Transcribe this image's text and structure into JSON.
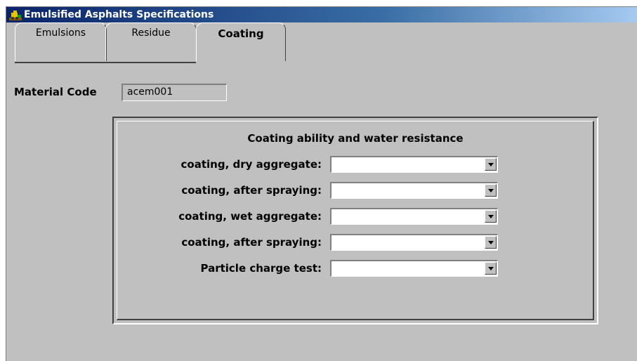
{
  "window": {
    "title": "Emulsified Asphalts Specifications",
    "icon": "bulldozer-app-icon"
  },
  "tabs": [
    {
      "label": "Emulsions",
      "active": false
    },
    {
      "label": "Residue",
      "active": false
    },
    {
      "label": "Coating",
      "active": true
    }
  ],
  "material_code": {
    "label": "Material Code",
    "value": "acem001"
  },
  "group": {
    "title": "Coating ability and water resistance",
    "fields": [
      {
        "label": "coating, dry aggregate:",
        "value": ""
      },
      {
        "label": "coating, after spraying:",
        "value": ""
      },
      {
        "label": "coating, wet aggregate:",
        "value": ""
      },
      {
        "label": "coating, after spraying:",
        "value": ""
      },
      {
        "label": "Particle charge test:",
        "value": ""
      }
    ]
  },
  "colors": {
    "titlebar_start": "#0a246a",
    "titlebar_end": "#a6caf0",
    "face": "#c0c0c0"
  }
}
